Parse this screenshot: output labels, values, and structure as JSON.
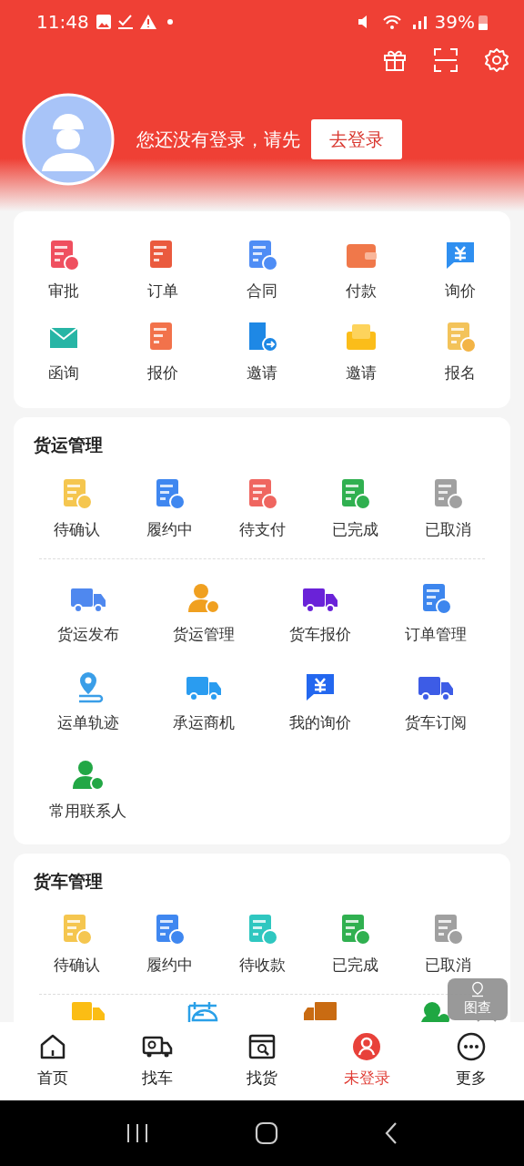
{
  "status_bar": {
    "time": "11:48",
    "battery": "39%"
  },
  "profile": {
    "prompt": "您还没有登录，请先",
    "login_button": "去登录"
  },
  "quick_menu": [
    {
      "label": "审批"
    },
    {
      "label": "订单"
    },
    {
      "label": "合同"
    },
    {
      "label": "付款"
    },
    {
      "label": "询价"
    },
    {
      "label": "函询"
    },
    {
      "label": "报价"
    },
    {
      "label": "邀请"
    },
    {
      "label": "邀请"
    },
    {
      "label": "报名"
    }
  ],
  "freight": {
    "title": "货运管理",
    "statuses": [
      {
        "label": "待确认"
      },
      {
        "label": "履约中"
      },
      {
        "label": "待支付"
      },
      {
        "label": "已完成"
      },
      {
        "label": "已取消"
      }
    ],
    "tools": [
      {
        "label": "货运发布"
      },
      {
        "label": "货运管理"
      },
      {
        "label": "货车报价"
      },
      {
        "label": "订单管理"
      },
      {
        "label": "运单轨迹"
      },
      {
        "label": "承运商机"
      },
      {
        "label": "我的询价"
      },
      {
        "label": "货车订阅"
      },
      {
        "label": "常用联系人"
      }
    ]
  },
  "truck": {
    "title": "货车管理",
    "statuses": [
      {
        "label": "待确认"
      },
      {
        "label": "履约中"
      },
      {
        "label": "待收款"
      },
      {
        "label": "已完成"
      },
      {
        "label": "已取消"
      }
    ]
  },
  "floating_button": {
    "label": "图查"
  },
  "bottom_nav": [
    {
      "label": "首页",
      "selected": false
    },
    {
      "label": "找车",
      "selected": false
    },
    {
      "label": "找货",
      "selected": false
    },
    {
      "label": "未登录",
      "selected": true
    },
    {
      "label": "更多",
      "selected": false
    }
  ]
}
